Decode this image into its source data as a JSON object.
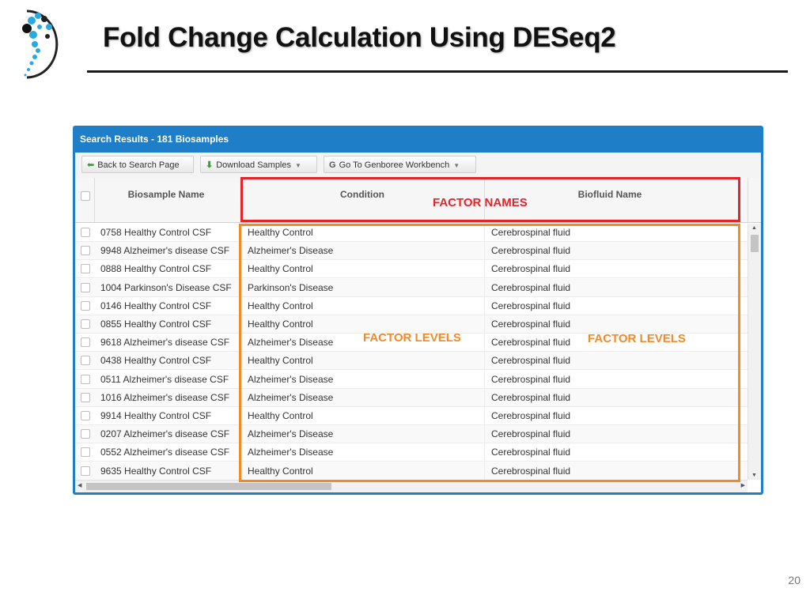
{
  "slide": {
    "title": "Fold Change Calculation Using DESeq2",
    "page_number": "20"
  },
  "panel": {
    "header": "Search Results - 181 Biosamples",
    "toolbar": {
      "back_label": "Back to Search Page",
      "download_label": "Download Samples",
      "workbench_label": "Go To Genboree Workbench"
    },
    "columns": [
      "Biosample Name",
      "Condition",
      "Biofluid Name"
    ],
    "rows": [
      {
        "name": "0758 Healthy Control CSF",
        "condition": "Healthy Control",
        "biofluid": "Cerebrospinal fluid"
      },
      {
        "name": "9948 Alzheimer's disease CSF",
        "condition": "Alzheimer's Disease",
        "biofluid": "Cerebrospinal fluid"
      },
      {
        "name": "0888 Healthy Control CSF",
        "condition": "Healthy Control",
        "biofluid": "Cerebrospinal fluid"
      },
      {
        "name": "1004 Parkinson's Disease CSF",
        "condition": "Parkinson's Disease",
        "biofluid": "Cerebrospinal fluid"
      },
      {
        "name": "0146 Healthy Control CSF",
        "condition": "Healthy Control",
        "biofluid": "Cerebrospinal fluid"
      },
      {
        "name": "0855 Healthy Control CSF",
        "condition": "Healthy Control",
        "biofluid": "Cerebrospinal fluid"
      },
      {
        "name": "9618 Alzheimer's disease CSF",
        "condition": "Alzheimer's Disease",
        "biofluid": "Cerebrospinal fluid"
      },
      {
        "name": "0438 Healthy Control CSF",
        "condition": "Healthy Control",
        "biofluid": "Cerebrospinal fluid"
      },
      {
        "name": "0511 Alzheimer's disease CSF",
        "condition": "Alzheimer's Disease",
        "biofluid": "Cerebrospinal fluid"
      },
      {
        "name": "1016 Alzheimer's disease CSF",
        "condition": "Alzheimer's Disease",
        "biofluid": "Cerebrospinal fluid"
      },
      {
        "name": "9914 Healthy Control CSF",
        "condition": "Healthy Control",
        "biofluid": "Cerebrospinal fluid"
      },
      {
        "name": "0207 Alzheimer's disease CSF",
        "condition": "Alzheimer's Disease",
        "biofluid": "Cerebrospinal fluid"
      },
      {
        "name": "0552 Alzheimer's disease CSF",
        "condition": "Alzheimer's Disease",
        "biofluid": "Cerebrospinal fluid"
      },
      {
        "name": "9635 Healthy Control CSF",
        "condition": "Healthy Control",
        "biofluid": "Cerebrospinal fluid"
      }
    ]
  },
  "annotations": {
    "factor_names": "FACTOR  NAMES",
    "factor_levels_left": "FACTOR LEVELS",
    "factor_levels_right": "FACTOR LEVELS"
  },
  "colors": {
    "panel_blue": "#1e7ec8",
    "annotation_red": "#e5232b",
    "annotation_orange": "#f28a27"
  },
  "icons": [
    "logo-icon",
    "back-arrow-icon",
    "download-icon",
    "genboree-icon",
    "chevron-down-icon",
    "scroll-up-icon",
    "scroll-down-icon",
    "scroll-left-icon",
    "scroll-right-icon"
  ]
}
